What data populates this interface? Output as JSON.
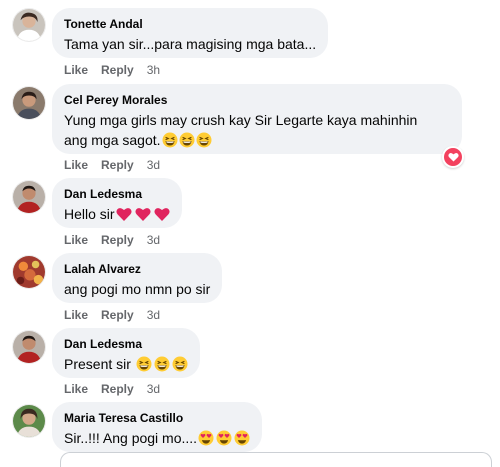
{
  "actions": {
    "like": "Like",
    "reply": "Reply"
  },
  "comments": [
    {
      "author": "Tonette Andal",
      "text": "Tama yan sir...para magising mga bata...",
      "time": "3h",
      "emojis": [],
      "reaction": null
    },
    {
      "author": "Cel Perey Morales",
      "text": "Yung mga girls may crush kay Sir Legarte kaya mahinhin",
      "text_line2": "ang mga sagot.",
      "time": "3d",
      "emojis": [
        "grinning-squint-face",
        "grinning-squint-face",
        "grinning-squint-face"
      ],
      "reaction": "love"
    },
    {
      "author": "Dan Ledesma",
      "text": "Hello sir",
      "time": "3d",
      "emojis": [
        "red-heart",
        "red-heart",
        "red-heart"
      ],
      "reaction": null
    },
    {
      "author": "Lalah Alvarez",
      "text": "ang pogi mo nmn po sir",
      "time": "3d",
      "emojis": [],
      "reaction": null
    },
    {
      "author": "Dan Ledesma",
      "text": "Present sir",
      "time": "3d",
      "emojis": [
        "grinning-squint-face",
        "grinning-squint-face",
        "grinning-squint-face"
      ],
      "reaction": null
    },
    {
      "author": "Maria Teresa Castillo",
      "text": "Sir..!!! Ang pogi mo....",
      "time": "",
      "emojis": [
        "heart-eyes-face",
        "heart-eyes-face",
        "heart-eyes-face"
      ],
      "reaction": null
    }
  ],
  "colors": {
    "bubble": "#f0f2f5",
    "meta_text": "#65676b",
    "love_reaction": "#f3425f",
    "heart": "#e0245e"
  }
}
